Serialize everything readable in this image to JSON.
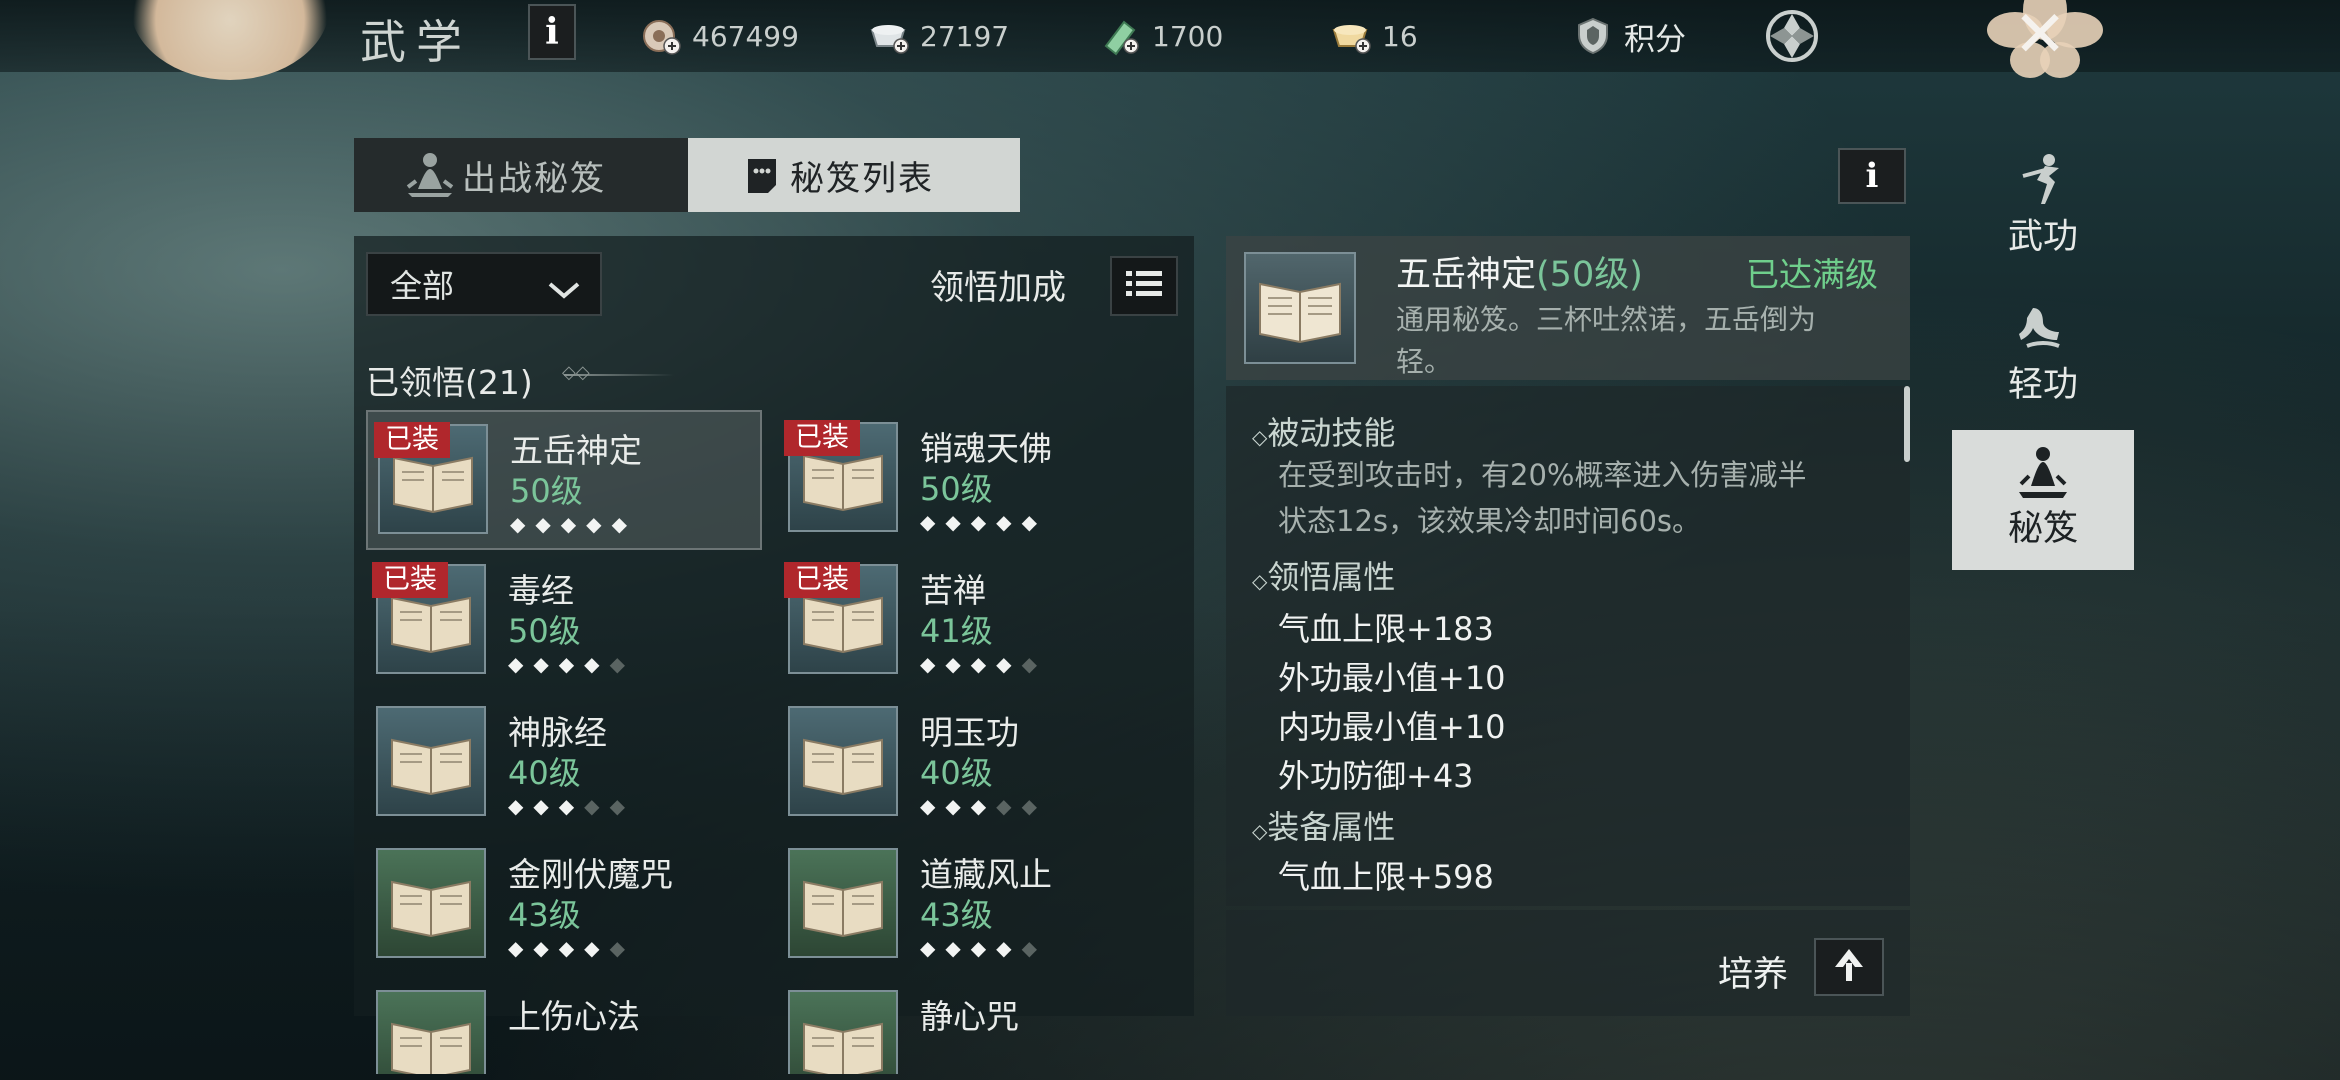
{
  "top": {
    "title": "武学",
    "info": "i",
    "currencies": [
      {
        "icon": "coin-stack-icon",
        "value": "467499"
      },
      {
        "icon": "silver-ingot-icon",
        "value": "27197"
      },
      {
        "icon": "jade-icon",
        "value": "1700"
      },
      {
        "icon": "gold-ingot-icon",
        "value": "16"
      }
    ],
    "points_label": "积分"
  },
  "tabs": {
    "battle": "出战秘笈",
    "list": "秘笈列表"
  },
  "filter": {
    "selected": "全部",
    "bonus_label": "领悟加成"
  },
  "learned_header": "已领悟(21)",
  "badge": "已装",
  "cards": [
    {
      "name": "五岳神定",
      "level": "50级",
      "stars": 5,
      "equipped": true
    },
    {
      "name": "销魂天佛",
      "level": "50级",
      "stars": 5,
      "equipped": true
    },
    {
      "name": "毒经",
      "level": "50级",
      "stars": 4,
      "equipped": true
    },
    {
      "name": "苦禅",
      "level": "41级",
      "stars": 4,
      "equipped": true
    },
    {
      "name": "神脉经",
      "level": "40级",
      "stars": 3,
      "equipped": false
    },
    {
      "name": "明玉功",
      "level": "40级",
      "stars": 3,
      "equipped": false
    },
    {
      "name": "金刚伏魔咒",
      "level": "43级",
      "stars": 4,
      "equipped": false
    },
    {
      "name": "道藏风止",
      "level": "43级",
      "stars": 4,
      "equipped": false
    },
    {
      "name": "上伤心法",
      "level": "",
      "stars": 0,
      "equipped": false
    },
    {
      "name": "静心咒",
      "level": "",
      "stars": 0,
      "equipped": false
    }
  ],
  "detail": {
    "name": "五岳神定",
    "level": "(50级)",
    "status": "已达满级",
    "desc_line1": "通用秘笈。三杯吐然诺，五岳倒为",
    "desc_line2": "轻。",
    "passive_title": "被动技能",
    "passive_line1": "在受到攻击时，有20%概率进入伤害减半",
    "passive_line2": "状态12s，该效果冷却时间60s。",
    "comprehend_title": "领悟属性",
    "comprehend_attrs": [
      "气血上限+183",
      "外功最小值+10",
      "内功最小值+10",
      "外功防御+43"
    ],
    "equip_title": "装备属性",
    "equip_attrs": [
      "气血上限+598"
    ],
    "cultivate": "培养"
  },
  "side_nav": [
    {
      "label": "武功",
      "icon": "martial-artist-icon"
    },
    {
      "label": "轻功",
      "icon": "qinggong-icon"
    },
    {
      "label": "秘笈",
      "icon": "meditation-icon"
    }
  ],
  "colors": {
    "level_green": "#7bc59a",
    "badge_red": "#b0272c",
    "max_green": "#6fcf8c"
  }
}
